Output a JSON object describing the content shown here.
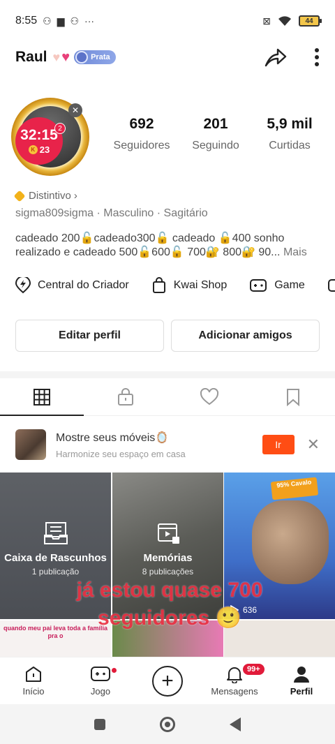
{
  "status_bar": {
    "time": "8:55",
    "battery": "44",
    "more": "···"
  },
  "header": {
    "username": "Raul",
    "level_badge": "Prata"
  },
  "profile": {
    "live_timer": "32:15",
    "live_level": "23",
    "live_k": "K",
    "notif_count": "2",
    "stats": [
      {
        "value": "692",
        "label": "Seguidores"
      },
      {
        "value": "201",
        "label": "Seguindo"
      },
      {
        "value": "5,9 mil",
        "label": "Curtidas"
      }
    ],
    "distintivo": "Distintivo",
    "meta": "sigma809sigma · Masculino · Sagitário",
    "bio": "cadeado 200🔓cadeado300🔓 cadeado 🔓400 sonho realizado e cadeado 500🔓600🔓 700🔐 800🔐 90...",
    "bio_more": "Mais"
  },
  "shortcuts": [
    {
      "label": "Central do Criador",
      "icon": "lightning-pin-icon"
    },
    {
      "label": "Kwai Shop",
      "icon": "shopping-bag-icon"
    },
    {
      "label": "Game",
      "icon": "gamepad-icon"
    }
  ],
  "buttons": {
    "edit": "Editar perfil",
    "add_friends": "Adicionar amigos"
  },
  "tabs": [
    {
      "name": "grid",
      "icon": "grid-icon",
      "active": true
    },
    {
      "name": "private",
      "icon": "lock-icon"
    },
    {
      "name": "likes",
      "icon": "heart-icon"
    },
    {
      "name": "saved",
      "icon": "bookmark-icon"
    }
  ],
  "promo": {
    "title": "Mostre seus móveis🪞",
    "subtitle": "Harmonize seu espaço em casa",
    "button": "Ir"
  },
  "grid": {
    "drafts": {
      "title": "Caixa de Rascunhos",
      "sub": "1 publicação"
    },
    "memories": {
      "title": "Memórias",
      "sub": "8 publicações"
    },
    "video_views": "636",
    "sticker": "95% Cavalo",
    "row2_text": "quando meu pai leva toda a família pra o"
  },
  "overlay_caption": "já estou quase 700 seguidores 🙂",
  "bottom_nav": [
    {
      "label": "Início",
      "icon": "home-icon"
    },
    {
      "label": "Jogo",
      "icon": "gamepad-icon"
    },
    {
      "label": "",
      "icon": "plus-icon"
    },
    {
      "label": "Mensagens",
      "icon": "bell-icon",
      "badge": "99+"
    },
    {
      "label": "Perfil",
      "icon": "person-icon",
      "active": true
    }
  ]
}
